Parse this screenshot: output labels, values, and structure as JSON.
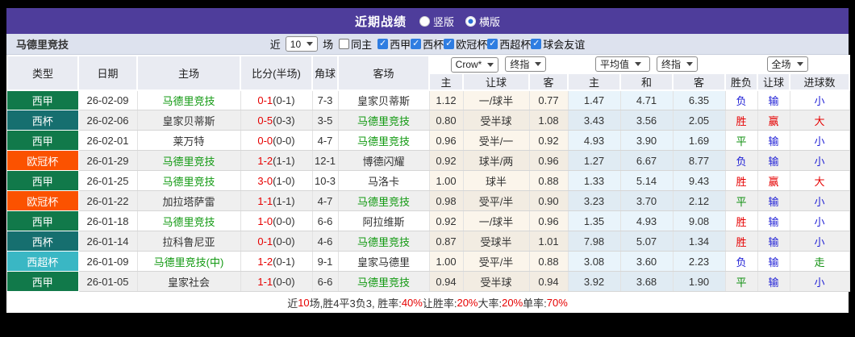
{
  "title_bar": {
    "title": "近期战绩",
    "view_options": [
      {
        "label": "竖版",
        "selected": false
      },
      {
        "label": "横版",
        "selected": true
      }
    ]
  },
  "filter_bar": {
    "team": "马德里竞技",
    "recent_label": "近",
    "recent_count": "10",
    "unit_label": "场",
    "same_venue": {
      "label": "同主",
      "checked": false
    },
    "league_filters": [
      {
        "label": "西甲",
        "checked": true
      },
      {
        "label": "西杯",
        "checked": true
      },
      {
        "label": "欧冠杯",
        "checked": true
      },
      {
        "label": "西超杯",
        "checked": true
      },
      {
        "label": "球会友谊",
        "checked": true
      }
    ]
  },
  "table": {
    "static_headers": [
      "类型",
      "日期",
      "主场",
      "比分(半场)",
      "角球",
      "客场"
    ],
    "dropdowns": {
      "bookmaker": "Crow*",
      "asia_period": "终指",
      "europe_avg": "平均值",
      "europe_period": "终指",
      "scope": "全场"
    },
    "sub_headers": [
      "主",
      "让球",
      "客",
      "主",
      "和",
      "客",
      "胜负",
      "让球",
      "进球数"
    ],
    "rows": [
      {
        "league": "西甲",
        "date": "26-02-09",
        "home": "马德里竞技",
        "home_self": true,
        "score": "0-1",
        "half": "(0-1)",
        "corners": "7-3",
        "away": "皇家贝蒂斯",
        "away_self": false,
        "asia": [
          "1.12",
          "一/球半",
          "0.77"
        ],
        "europe": [
          "1.47",
          "4.71",
          "6.35"
        ],
        "outcome": {
          "text": "负",
          "color": "blue"
        },
        "handicap_outcome": {
          "text": "输",
          "color": "blue"
        },
        "goals_outcome": {
          "text": "小",
          "color": "blue"
        }
      },
      {
        "league": "西杯",
        "date": "26-02-06",
        "home": "皇家贝蒂斯",
        "home_self": false,
        "score": "0-5",
        "half": "(0-3)",
        "corners": "3-5",
        "away": "马德里竞技",
        "away_self": true,
        "asia": [
          "0.80",
          "受半球",
          "1.08"
        ],
        "europe": [
          "3.43",
          "3.56",
          "2.05"
        ],
        "outcome": {
          "text": "胜",
          "color": "red"
        },
        "handicap_outcome": {
          "text": "赢",
          "color": "red"
        },
        "goals_outcome": {
          "text": "大",
          "color": "red"
        }
      },
      {
        "league": "西甲",
        "date": "26-02-01",
        "home": "莱万特",
        "home_self": false,
        "score": "0-0",
        "half": "(0-0)",
        "corners": "4-7",
        "away": "马德里竞技",
        "away_self": true,
        "asia": [
          "0.96",
          "受半/一",
          "0.92"
        ],
        "europe": [
          "4.93",
          "3.90",
          "1.69"
        ],
        "outcome": {
          "text": "平",
          "color": "green"
        },
        "handicap_outcome": {
          "text": "输",
          "color": "blue"
        },
        "goals_outcome": {
          "text": "小",
          "color": "blue"
        }
      },
      {
        "league": "欧冠杯",
        "date": "26-01-29",
        "home": "马德里竞技",
        "home_self": true,
        "score": "1-2",
        "half": "(1-1)",
        "corners": "12-1",
        "away": "博德闪耀",
        "away_self": false,
        "asia": [
          "0.92",
          "球半/两",
          "0.96"
        ],
        "europe": [
          "1.27",
          "6.67",
          "8.77"
        ],
        "outcome": {
          "text": "负",
          "color": "blue"
        },
        "handicap_outcome": {
          "text": "输",
          "color": "blue"
        },
        "goals_outcome": {
          "text": "小",
          "color": "blue"
        }
      },
      {
        "league": "西甲",
        "date": "26-01-25",
        "home": "马德里竞技",
        "home_self": true,
        "score": "3-0",
        "half": "(1-0)",
        "corners": "10-3",
        "away": "马洛卡",
        "away_self": false,
        "asia": [
          "1.00",
          "球半",
          "0.88"
        ],
        "europe": [
          "1.33",
          "5.14",
          "9.43"
        ],
        "outcome": {
          "text": "胜",
          "color": "red"
        },
        "handicap_outcome": {
          "text": "赢",
          "color": "red"
        },
        "goals_outcome": {
          "text": "大",
          "color": "red"
        }
      },
      {
        "league": "欧冠杯",
        "date": "26-01-22",
        "home": "加拉塔萨雷",
        "home_self": false,
        "score": "1-1",
        "half": "(1-1)",
        "corners": "4-7",
        "away": "马德里竞技",
        "away_self": true,
        "asia": [
          "0.98",
          "受平/半",
          "0.90"
        ],
        "europe": [
          "3.23",
          "3.70",
          "2.12"
        ],
        "outcome": {
          "text": "平",
          "color": "green"
        },
        "handicap_outcome": {
          "text": "输",
          "color": "blue"
        },
        "goals_outcome": {
          "text": "小",
          "color": "blue"
        }
      },
      {
        "league": "西甲",
        "date": "26-01-18",
        "home": "马德里竞技",
        "home_self": true,
        "score": "1-0",
        "half": "(0-0)",
        "corners": "6-6",
        "away": "阿拉维斯",
        "away_self": false,
        "asia": [
          "0.92",
          "一/球半",
          "0.96"
        ],
        "europe": [
          "1.35",
          "4.93",
          "9.08"
        ],
        "outcome": {
          "text": "胜",
          "color": "red"
        },
        "handicap_outcome": {
          "text": "输",
          "color": "blue"
        },
        "goals_outcome": {
          "text": "小",
          "color": "blue"
        }
      },
      {
        "league": "西杯",
        "date": "26-01-14",
        "home": "拉科鲁尼亚",
        "home_self": false,
        "score": "0-1",
        "half": "(0-0)",
        "corners": "4-6",
        "away": "马德里竞技",
        "away_self": true,
        "asia": [
          "0.87",
          "受球半",
          "1.01"
        ],
        "europe": [
          "7.98",
          "5.07",
          "1.34"
        ],
        "outcome": {
          "text": "胜",
          "color": "red"
        },
        "handicap_outcome": {
          "text": "输",
          "color": "blue"
        },
        "goals_outcome": {
          "text": "小",
          "color": "blue"
        }
      },
      {
        "league": "西超杯",
        "date": "26-01-09",
        "home": "马德里竞技(中)",
        "home_self": true,
        "score": "1-2",
        "half": "(0-1)",
        "corners": "9-1",
        "away": "皇家马德里",
        "away_self": false,
        "asia": [
          "1.00",
          "受平/半",
          "0.88"
        ],
        "europe": [
          "3.08",
          "3.60",
          "2.23"
        ],
        "outcome": {
          "text": "负",
          "color": "blue"
        },
        "handicap_outcome": {
          "text": "输",
          "color": "blue"
        },
        "goals_outcome": {
          "text": "走",
          "color": "green"
        }
      },
      {
        "league": "西甲",
        "date": "26-01-05",
        "home": "皇家社会",
        "home_self": false,
        "score": "1-1",
        "half": "(0-0)",
        "corners": "6-6",
        "away": "马德里竞技",
        "away_self": true,
        "asia": [
          "0.94",
          "受半球",
          "0.94"
        ],
        "europe": [
          "3.92",
          "3.68",
          "1.90"
        ],
        "outcome": {
          "text": "平",
          "color": "green"
        },
        "handicap_outcome": {
          "text": "输",
          "color": "blue"
        },
        "goals_outcome": {
          "text": "小",
          "color": "blue"
        }
      }
    ]
  },
  "summary": {
    "segments": [
      {
        "text": "近",
        "red": false
      },
      {
        "text": "10",
        "red": true
      },
      {
        "text": "场,胜4平3负3, 胜率:",
        "red": false
      },
      {
        "text": "40%",
        "red": true
      },
      {
        "text": " 让胜率:",
        "red": false
      },
      {
        "text": "20%",
        "red": true
      },
      {
        "text": " 大率:",
        "red": false
      },
      {
        "text": "20%",
        "red": true
      },
      {
        "text": " 单率:",
        "red": false
      },
      {
        "text": "70%",
        "red": true
      }
    ]
  },
  "colors": {
    "accent_purple": "#4e3d9b",
    "league": {
      "西甲": "#11794a",
      "西杯": "#166f6f",
      "欧冠杯": "#fb5200",
      "西超杯": "#3ab7c4"
    },
    "result": {
      "red": "#e60000",
      "blue": "#2121d6",
      "green": "#0f8f0f"
    },
    "self_team_green": "#119911",
    "score_red": "#e60000"
  }
}
